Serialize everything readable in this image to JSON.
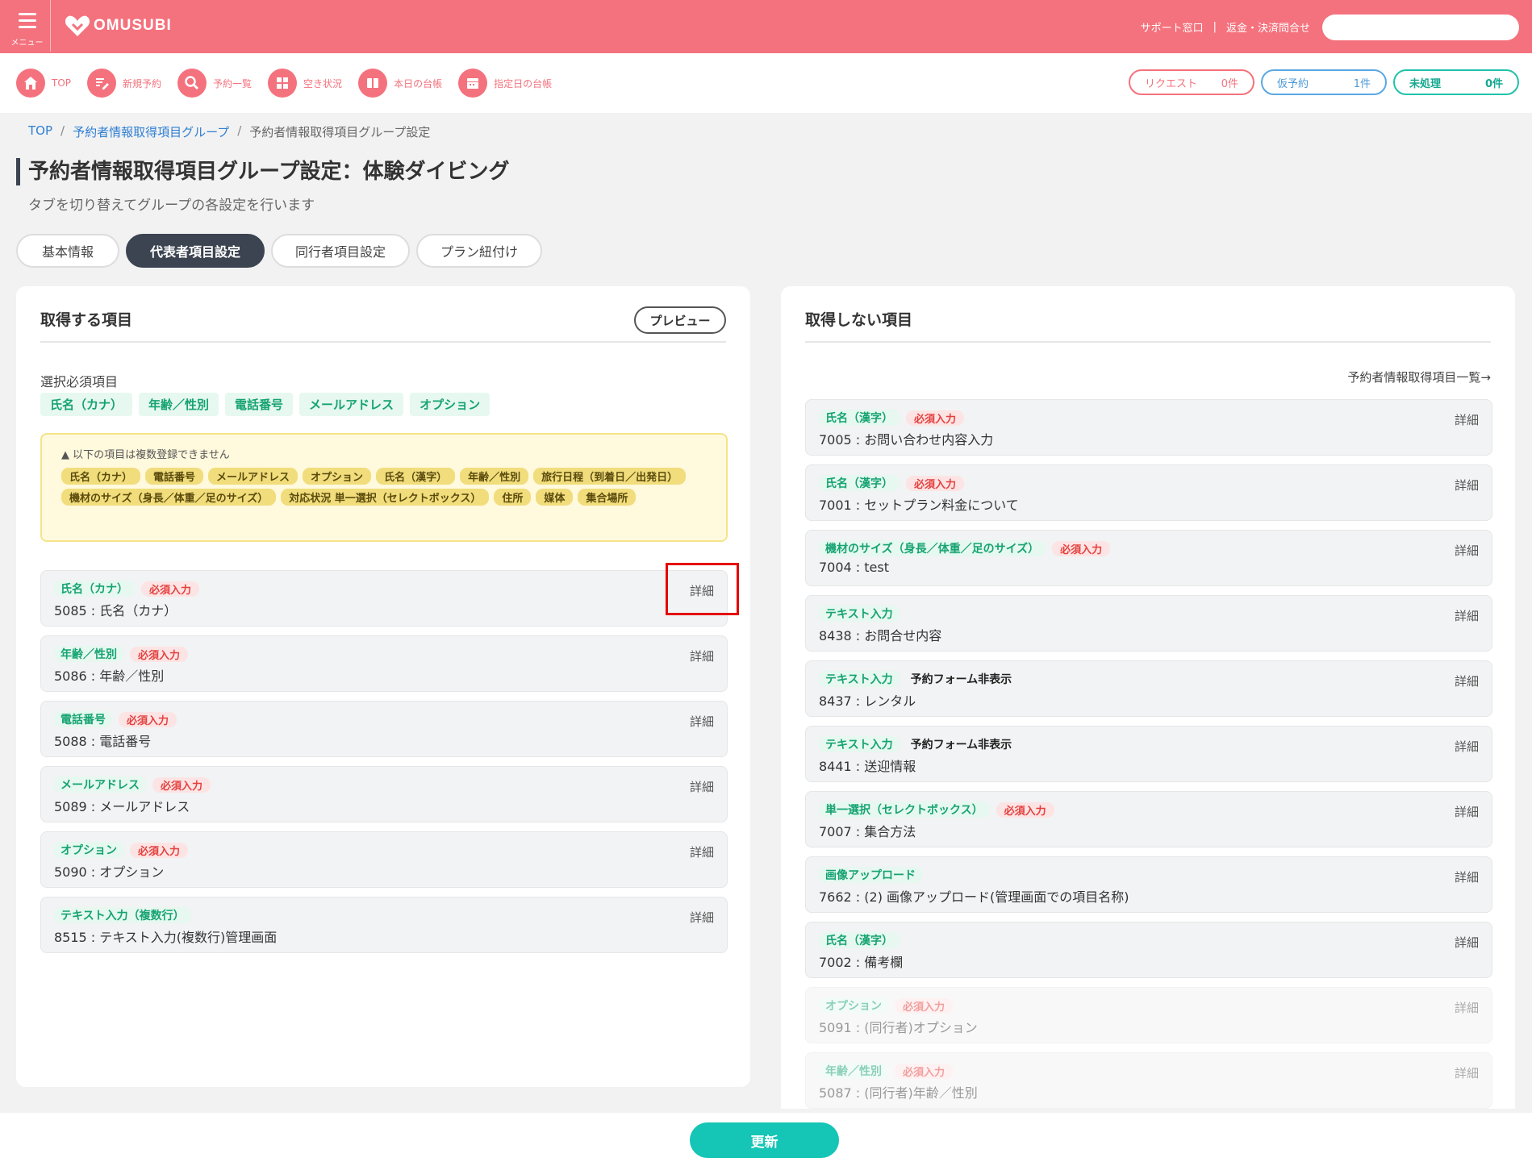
{
  "header": {
    "menu_label": "メニュー",
    "logo": "OMUSUBI",
    "support_link": "サポート窓口",
    "refund_link": "返金・決済問合せ",
    "search_placeholder": ""
  },
  "nav": {
    "items": [
      {
        "label": "TOP",
        "icon": "home-icon"
      },
      {
        "label": "新規予約",
        "icon": "edit-icon"
      },
      {
        "label": "予約一覧",
        "icon": "search-icon"
      },
      {
        "label": "空き状況",
        "icon": "grid-icon"
      },
      {
        "label": "本日の台帳",
        "icon": "book-icon"
      },
      {
        "label": "指定日の台帳",
        "icon": "calendar-icon"
      }
    ],
    "status": {
      "request": {
        "label": "リクエスト",
        "count": "0件"
      },
      "temp": {
        "label": "仮予約",
        "count": "1件"
      },
      "pending": {
        "label": "未処理",
        "count": "0件"
      }
    }
  },
  "breadcrumb": {
    "top": "TOP",
    "group": "予約者情報取得項目グループ",
    "current": "予約者情報取得項目グループ設定"
  },
  "page": {
    "title": "予約者情報取得項目グループ設定：体験ダイビング",
    "subtitle": "タブを切り替えてグループの各設定を行います"
  },
  "tabs": [
    "基本情報",
    "代表者項目設定",
    "同行者項目設定",
    "プラン紐付け"
  ],
  "left": {
    "title": "取得する項目",
    "preview_label": "プレビュー",
    "required_label": "選択必須項目",
    "required_items": [
      "氏名（カナ）",
      "年齢／性別",
      "電話番号",
      "メールアドレス",
      "オプション"
    ],
    "warning_title": "以下の項目は複数登録できません",
    "warning_items": [
      "氏名（カナ）",
      "電話番号",
      "メールアドレス",
      "オプション",
      "氏名（漢字）",
      "年齢／性別",
      "旅行日程（到着日／出発日）",
      "機材のサイズ（身長／体重／足のサイズ）",
      "対応状況 単一選択（セレクトボックス）",
      "住所",
      "媒体",
      "集合場所"
    ],
    "items": [
      {
        "type": "氏名（カナ）",
        "req": "必須入力",
        "name": "5085 : 氏名（カナ）",
        "detail": "詳細"
      },
      {
        "type": "年齢／性別",
        "req": "必須入力",
        "name": "5086 : 年齢／性別",
        "detail": "詳細"
      },
      {
        "type": "電話番号",
        "req": "必須入力",
        "name": "5088 : 電話番号",
        "detail": "詳細"
      },
      {
        "type": "メールアドレス",
        "req": "必須入力",
        "name": "5089 : メールアドレス",
        "detail": "詳細"
      },
      {
        "type": "オプション",
        "req": "必須入力",
        "name": "5090 : オプション",
        "detail": "詳細"
      },
      {
        "type": "テキスト入力（複数行）",
        "req": "",
        "name": "8515 : テキスト入力(複数行)管理画面",
        "detail": "詳細"
      }
    ]
  },
  "right": {
    "title": "取得しない項目",
    "list_link": "予約者情報取得項目一覧→",
    "items": [
      {
        "type": "氏名（漢字）",
        "req": "必須入力",
        "hidden": "",
        "name": "7005 : お問い合わせ内容入力",
        "detail": "詳細"
      },
      {
        "type": "氏名（漢字）",
        "req": "必須入力",
        "hidden": "",
        "name": "7001 : セットプラン料金について",
        "detail": "詳細"
      },
      {
        "type": "機材のサイズ（身長／体重／足のサイズ）",
        "req": "必須入力",
        "hidden": "",
        "name": "7004 : test",
        "detail": "詳細"
      },
      {
        "type": "テキスト入力",
        "req": "",
        "hidden": "",
        "name": "8438 : お問合せ内容",
        "detail": "詳細"
      },
      {
        "type": "テキスト入力",
        "req": "",
        "hidden": "予約フォーム非表示",
        "name": "8437 : レンタル",
        "detail": "詳細"
      },
      {
        "type": "テキスト入力",
        "req": "",
        "hidden": "予約フォーム非表示",
        "name": "8441 : 送迎情報",
        "detail": "詳細"
      },
      {
        "type": "単一選択（セレクトボックス）",
        "req": "必須入力",
        "hidden": "",
        "name": "7007 : 集合方法",
        "detail": "詳細"
      },
      {
        "type": "画像アップロード",
        "req": "",
        "hidden": "",
        "name": "7662 : (2) 画像アップロード(管理画面での項目名称)",
        "detail": "詳細"
      },
      {
        "type": "氏名（漢字）",
        "req": "",
        "hidden": "",
        "name": "7002 : 備考欄",
        "detail": "詳細"
      },
      {
        "type": "オプション",
        "req": "必須入力",
        "hidden": "",
        "name": "5091 : (同行者)オプション",
        "detail": "詳細"
      },
      {
        "type": "年齢／性別",
        "req": "必須入力",
        "hidden": "",
        "name": "5087 : (同行者)年齢／性別",
        "detail": "詳細"
      }
    ]
  },
  "footer": {
    "submit_label": "更新"
  },
  "colors": {
    "brand": "#f4727d",
    "accent": "#15c5b5",
    "tag_green": "#16a373",
    "tag_red": "#e4403e",
    "highlight": "#e40000"
  }
}
